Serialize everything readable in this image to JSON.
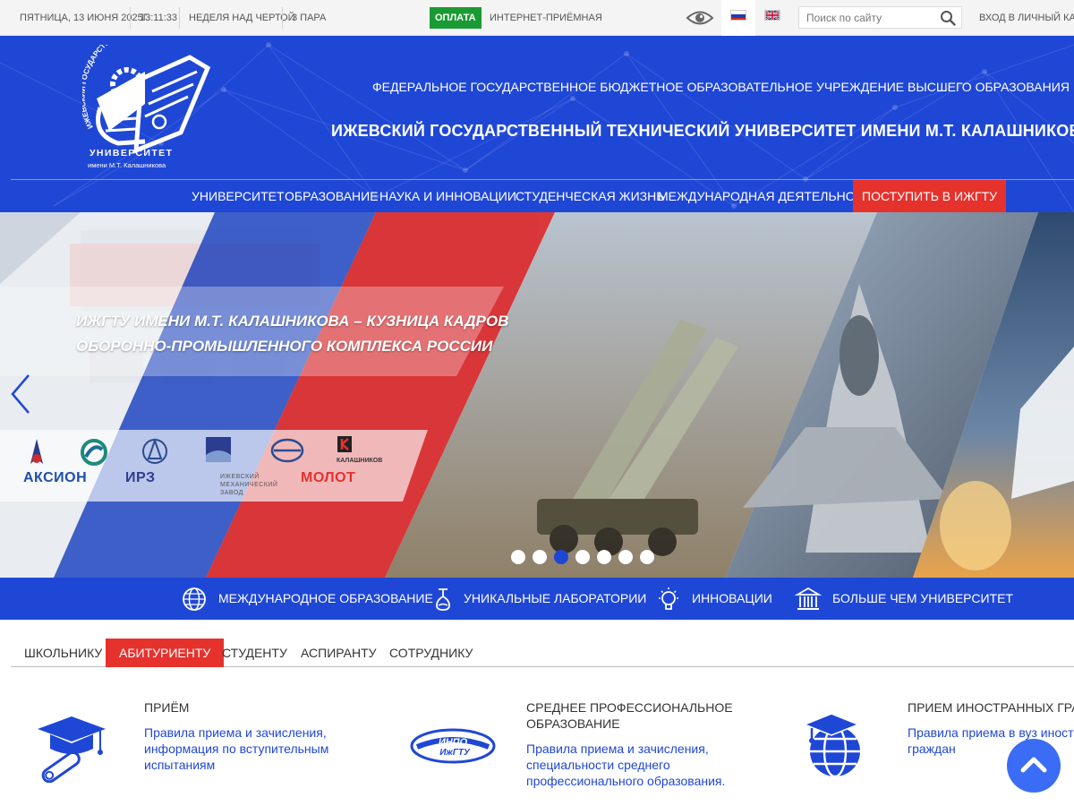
{
  "topbar": {
    "date": "ПЯТНИЦА, 13 ИЮНЯ 2025Г.",
    "time": "13:11:33",
    "week": "НЕДЕЛЯ НАД ЧЕРТОЙ",
    "lesson": "3 ПАРА",
    "pay_label": "ОПЛАТА",
    "reception_label": "ИНТЕРНЕТ-ПРИЁМНАЯ",
    "search_placeholder": "Поиск по сайту",
    "login_label": "ВХОД В ЛИЧНЫЙ КАБИНЕТ"
  },
  "header": {
    "logo_arc_text": "ИЖЕВСКИЙ ГОСУДАРСТВЕННЫЙ ТЕХНИЧЕСКИЙ",
    "logo_word": "УНИВЕРСИТЕТ",
    "logo_name": "имени М.Т. Калашникова",
    "subtitle": "ФЕДЕРАЛЬНОЕ ГОСУДАРСТВЕННОЕ БЮДЖЕТНОЕ ОБРАЗОВАТЕЛЬНОЕ УЧРЕЖДЕНИЕ ВЫСШЕГО ОБРАЗОВАНИЯ",
    "title": "ИЖЕВСКИЙ ГОСУДАРСТВЕННЫЙ ТЕХНИЧЕСКИЙ УНИВЕРСИТЕТ ИМЕНИ М.Т. КАЛАШНИКОВА"
  },
  "nav": {
    "items": [
      "УНИВЕРСИТЕТ",
      "ОБРАЗОВАНИЕ",
      "НАУКА И ИННОВАЦИИ",
      "СТУДЕНЧЕСКАЯ ЖИЗНЬ",
      "МЕЖДУНАРОДНАЯ ДЕЯТЕЛЬНОСТЬ"
    ],
    "apply": "ПОСТУПИТЬ В ИЖГТУ"
  },
  "slider": {
    "caption_line1": "ИжГТУ имени М.Т. КАЛАШНИКОВА – КУЗНИЦА КАДРОВ",
    "caption_line2": "ОБОРОННО-ПРОМЫШЛЕННОГО КОМПЛЕКСА РОССИИ",
    "slide_count": 7,
    "active_slide": 3,
    "partners": [
      "КАЛАШНИКОВ",
      "АКСИОН",
      "ИРЗ",
      "ИЖЕВСКИЙ МЕХАНИЧЕСКИЙ ЗАВОД",
      "МОЛОТ"
    ]
  },
  "features": [
    {
      "label": "МЕЖДУНАРОДНОЕ ОБРАЗОВАНИЕ",
      "icon": "globe-icon"
    },
    {
      "label": "УНИКАЛЬНЫЕ ЛАБОРАТОРИИ",
      "icon": "flask-icon"
    },
    {
      "label": "ИННОВАЦИИ",
      "icon": "lightbulb-icon"
    },
    {
      "label": "БОЛЬШЕ ЧЕМ УНИВЕРСИТЕТ",
      "icon": "building-icon"
    }
  ],
  "tabs": [
    "ШКОЛЬНИКУ",
    "АБИТУРИЕНТУ",
    "СТУДЕНТУ",
    "АСПИРАНТУ",
    "СОТРУДНИКУ"
  ],
  "active_tab": "АБИТУРИЕНТУ",
  "cards": [
    {
      "title": "ПРИЁМ",
      "text": [
        "Правила приема и зачисления,",
        "информация по вступительным",
        "испытаниям"
      ],
      "icon": "graduation-cap-icon"
    },
    {
      "title": [
        "СРЕДНЕЕ ПРОФЕССИОНАЛЬНОЕ",
        "ОБРАЗОВАНИЕ"
      ],
      "text": [
        "Правила приема и зачисления,",
        "специальности среднего",
        "профессионального образования."
      ],
      "icon": "inpo-logo",
      "logo_text": "ИНПО",
      "logo_sub": "ИжГТУ"
    },
    {
      "title": "ПРИЕМ ИНОСТРАННЫХ ГРАЖДАН",
      "text": [
        "Правила приема в вуз иностранных",
        "граждан"
      ],
      "icon": "globe-cap-icon"
    }
  ],
  "colors": {
    "brand_blue": "#1f47d6",
    "accent_red": "#e5322d",
    "pay_green": "#1a9a33"
  }
}
